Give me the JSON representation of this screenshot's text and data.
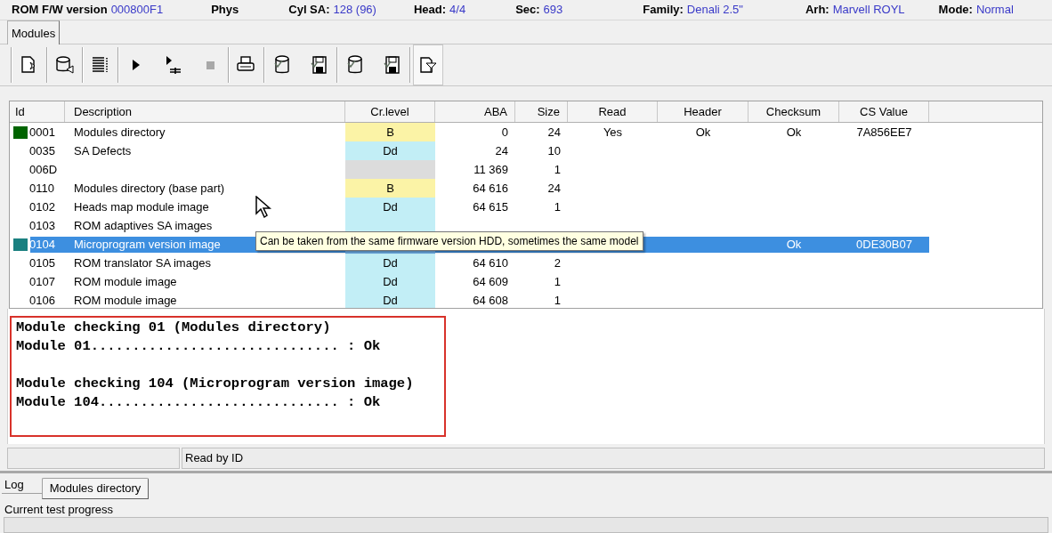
{
  "info_bar": [
    {
      "label": "ROM F/W version",
      "value": "000800F1"
    },
    {
      "label": "Phys"
    },
    {
      "label": "Cyl SA:",
      "value": "128 (96)"
    },
    {
      "label": "Head:",
      "value": "4/4"
    },
    {
      "label": "Sec:",
      "value": "693"
    },
    {
      "label": "Family:",
      "value": "Denali 2.5\""
    },
    {
      "label": "Arh:",
      "value": "Marvell ROYL"
    },
    {
      "label": "Mode:",
      "value": "Normal"
    }
  ],
  "top_tabs": [
    {
      "label": "Modules",
      "selected": true
    }
  ],
  "toolbar_groups": [
    [
      {
        "kind": "page-star",
        "disabled": false,
        "pressed": false
      }
    ],
    [
      {
        "kind": "cylinder-arrow",
        "disabled": false,
        "pressed": false
      }
    ],
    [
      {
        "kind": "list",
        "disabled": false,
        "pressed": false
      }
    ],
    [
      {
        "kind": "play",
        "disabled": false,
        "pressed": false
      },
      {
        "kind": "step",
        "disabled": false,
        "pressed": false
      },
      {
        "kind": "stop",
        "disabled": true,
        "pressed": false
      }
    ],
    [
      {
        "kind": "printer",
        "disabled": false,
        "pressed": false
      }
    ],
    [
      {
        "kind": "cylinder",
        "disabled": false,
        "pressed": false
      },
      {
        "kind": "floppy",
        "disabled": false,
        "pressed": false
      }
    ],
    [
      {
        "kind": "cylinder",
        "disabled": false,
        "pressed": false
      },
      {
        "kind": "floppy",
        "disabled": false,
        "pressed": false
      }
    ],
    [
      {
        "kind": "page-filter",
        "disabled": false,
        "pressed": true
      }
    ]
  ],
  "table": {
    "columns": [
      "Id",
      "Description",
      "Cr.level",
      "ABA",
      "Size",
      "Read",
      "Header",
      "Checksum",
      "CS Value"
    ],
    "rows": [
      {
        "id": "0001",
        "color": "#006400",
        "selected": false,
        "kind": "b",
        "description": "Modules directory",
        "cr_level": "B",
        "aba": "0",
        "size": "24",
        "read": "Yes",
        "header": "Ok",
        "checksum": "Ok",
        "cs_value": "7A856EE7"
      },
      {
        "id": "0035",
        "selected": false,
        "kind": "dd",
        "description": "SA Defects",
        "cr_level": "Dd",
        "aba": "24",
        "size": "10"
      },
      {
        "id": "006D",
        "selected": false,
        "kind": "blank",
        "aba": "11 369",
        "size": "1"
      },
      {
        "id": "0110",
        "selected": false,
        "kind": "b",
        "description": "Modules directory (base part)",
        "cr_level": "B",
        "aba": "64 616",
        "size": "24"
      },
      {
        "id": "0102",
        "selected": false,
        "kind": "dd",
        "description": "Heads map module image",
        "cr_level": "Dd",
        "aba": "64 615",
        "size": "1"
      },
      {
        "id": "0103",
        "selected": false,
        "kind": "dd",
        "description": "ROM adaptives SA images"
      },
      {
        "id": "0104",
        "color": "#1a8080",
        "selected": true,
        "kind": "dd",
        "description": "Microprogram version image",
        "checksum": "Ok",
        "cs_value": "0DE30B07"
      },
      {
        "id": "0105",
        "selected": false,
        "kind": "dd",
        "description": "ROM translator SA images",
        "cr_level": "Dd",
        "aba": "64 610",
        "size": "2"
      },
      {
        "id": "0107",
        "selected": false,
        "kind": "dd",
        "description": "ROM module image",
        "cr_level": "Dd",
        "aba": "64 609",
        "size": "1"
      },
      {
        "id": "0106",
        "selected": false,
        "kind": "dd",
        "description": "ROM module image",
        "cr_level": "Dd",
        "aba": "64 608",
        "size": "1"
      }
    ]
  },
  "tooltip": "Can be taken from the same firmware version HDD, sometimes the same model",
  "log_blocks": [
    [
      "Module checking 01 (Modules directory)",
      "Module 01.............................. : Ok"
    ],
    [
      "Module checking 104 (Microprogram version image)",
      "Module 104............................. : Ok"
    ]
  ],
  "status_bar": {
    "text": "Read by ID"
  },
  "bottom_tabs": [
    {
      "label": "Log",
      "selected": false
    },
    {
      "label": "Modules directory",
      "selected": true
    }
  ],
  "progress": {
    "label": "Current test progress",
    "level": 0
  }
}
